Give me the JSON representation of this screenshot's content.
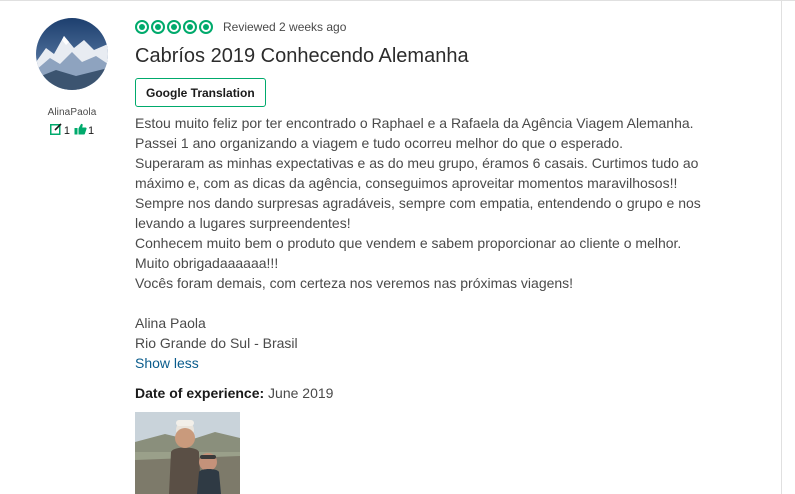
{
  "reviewer": {
    "name": "AlinaPaola",
    "contributions": "1",
    "helpful_votes": "1"
  },
  "review": {
    "rating": 5,
    "reviewed_text": "Reviewed 2 weeks ago",
    "title": "Cabríos 2019 Conhecendo Alemanha",
    "translate_button": "Google Translation",
    "body_lines": [
      "Estou muito feliz por ter encontrado o Raphael e a Rafaela da Agência Viagem Alemanha.",
      "Passei 1 ano organizando a viagem e tudo ocorreu melhor do que o esperado.",
      "Superaram as minhas expectativas e as do meu grupo, éramos 6 casais. Curtimos tudo ao",
      "máximo e, com as dicas da agência, conseguimos aproveitar momentos maravilhosos!!",
      "Sempre nos dando surpresas agradáveis, sempre com empatia, entendendo o grupo e nos",
      "levando a lugares surpreendentes!",
      "Conhecem muito bem o produto que vendem e sabem proporcionar ao cliente o melhor.",
      "Muito obrigadaaaaaa!!!",
      "Vocês foram demais, com certeza nos veremos nas próximas viagens!"
    ],
    "signature_lines": [
      "Alina Paola",
      "Rio Grande do Sul - Brasil"
    ],
    "show_less": "Show less",
    "experience_label": "Date of experience:",
    "experience_value": " June 2019"
  },
  "colors": {
    "accent_green": "#00aa6c",
    "link_blue": "#0a5c8c"
  },
  "icons": {
    "contributions": "edit-square-icon",
    "helpful": "thumbs-up-icon"
  }
}
